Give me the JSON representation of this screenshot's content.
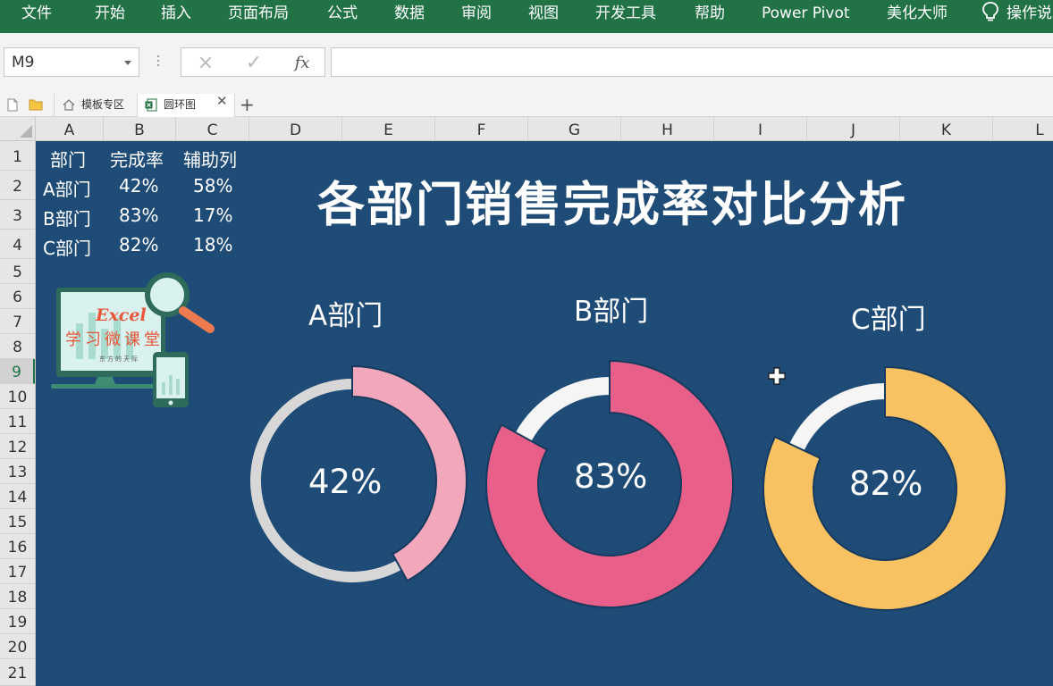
{
  "ribbon": {
    "menu": [
      "文件",
      "开始",
      "插入",
      "页面布局",
      "公式",
      "数据",
      "审阅",
      "视图",
      "开发工具",
      "帮助",
      "Power Pivot",
      "美化大师"
    ],
    "tell_me": "操作说"
  },
  "formula_bar": {
    "name_box": "M9",
    "cancel_icon": "×",
    "enter_icon": "✓",
    "fx_label": "fx",
    "value": ""
  },
  "workbook_tabs": [
    {
      "label": "模板专区",
      "active": false
    },
    {
      "label": "圆环图",
      "active": true
    }
  ],
  "tab_add_label": "+",
  "columns": [
    "A",
    "B",
    "C",
    "D",
    "E",
    "F",
    "G",
    "H",
    "I",
    "J",
    "K",
    "L"
  ],
  "rows": [
    "1",
    "2",
    "3",
    "4",
    "5",
    "6",
    "7",
    "8",
    "9",
    "10",
    "11",
    "12",
    "13",
    "14",
    "15",
    "16",
    "17",
    "18",
    "19",
    "20",
    "21"
  ],
  "active_row": "9",
  "table": {
    "headers": [
      "部门",
      "完成率",
      "辅助列"
    ],
    "rows": [
      [
        "A部门",
        "42%",
        "58%"
      ],
      [
        "B部门",
        "83%",
        "17%"
      ],
      [
        "C部门",
        "82%",
        "18%"
      ]
    ]
  },
  "logo": {
    "brand": "Excel",
    "line1": "学习微课堂",
    "line2": "东方的天际"
  },
  "chart_data": [
    {
      "type": "pie",
      "title": "A部门",
      "categories": [
        "完成率",
        "辅助列"
      ],
      "values": [
        42,
        58
      ],
      "data_label": "42%",
      "colors": [
        "#f2a7bb",
        "#d7d7d7"
      ]
    },
    {
      "type": "pie",
      "title": "B部门",
      "categories": [
        "完成率",
        "辅助列"
      ],
      "values": [
        83,
        17
      ],
      "data_label": "83%",
      "colors": [
        "#e8608a",
        "#f5f5f5"
      ]
    },
    {
      "type": "pie",
      "title": "C部门",
      "categories": [
        "完成率",
        "辅助列"
      ],
      "values": [
        82,
        18
      ],
      "data_label": "82%",
      "colors": [
        "#f8c262",
        "#f5f5f5"
      ]
    }
  ],
  "sheet_title": "各部门销售完成率对比分析",
  "colors": {
    "ribbon": "#217346",
    "sheet_background": "#1f4b77"
  }
}
